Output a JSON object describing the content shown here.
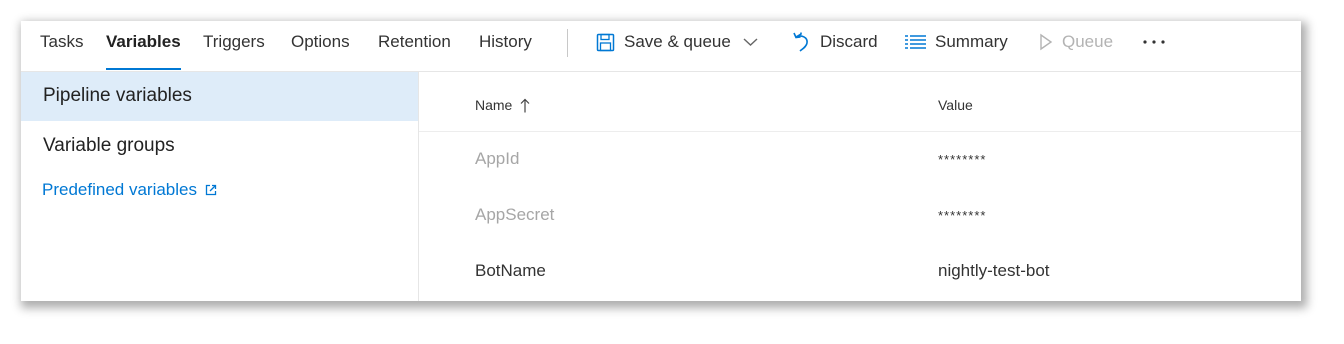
{
  "tabs": [
    {
      "label": "Tasks",
      "active": false
    },
    {
      "label": "Variables",
      "active": true
    },
    {
      "label": "Triggers",
      "active": false
    },
    {
      "label": "Options",
      "active": false
    },
    {
      "label": "Retention",
      "active": false
    },
    {
      "label": "History",
      "active": false
    }
  ],
  "toolbar": {
    "save_queue_label": "Save & queue",
    "discard_label": "Discard",
    "summary_label": "Summary",
    "queue_label": "Queue",
    "icons": [
      "save-icon",
      "chevron-down-icon",
      "undo-icon",
      "list-icon",
      "play-icon",
      "more-icon"
    ]
  },
  "left_nav": {
    "items": [
      {
        "label": "Pipeline variables",
        "selected": true
      },
      {
        "label": "Variable groups",
        "selected": false
      }
    ],
    "link_label": "Predefined variables"
  },
  "grid": {
    "columns": {
      "name": "Name",
      "value": "Value"
    },
    "rows": [
      {
        "name": "AppId",
        "value": "********"
      },
      {
        "name": "AppSecret",
        "value": "********"
      },
      {
        "name": "BotName",
        "value": "nightly-test-bot"
      }
    ]
  },
  "colors": {
    "accent": "#0078d4",
    "selected_bg": "#deecf9",
    "disabled_text": "#b3b3b3"
  }
}
